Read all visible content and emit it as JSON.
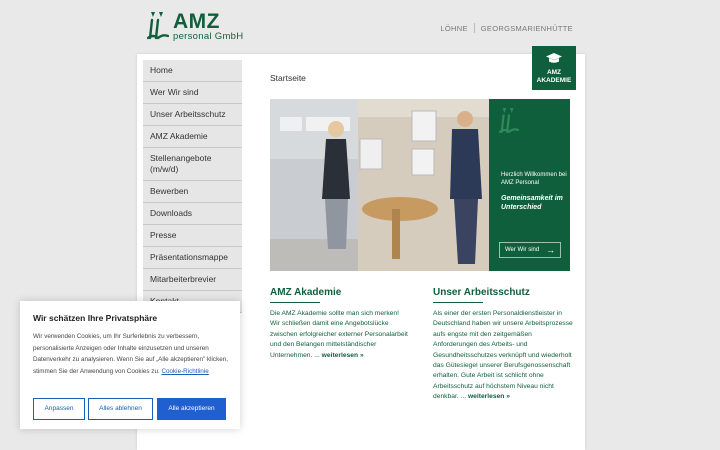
{
  "brand": {
    "title": "AMZ",
    "subtitle": "personal GmbH",
    "color": "#0f5f3c"
  },
  "topnav": {
    "items": [
      "LÖHNE",
      "GEORGSMARIENHÜTTE"
    ]
  },
  "sidebar": {
    "items": [
      {
        "label": "Home"
      },
      {
        "label": "Wer Wir sind"
      },
      {
        "label": "Unser Arbeitsschutz"
      },
      {
        "label": "AMZ Akademie"
      },
      {
        "label": "Stellenangebote (m/w/d)"
      },
      {
        "label": "Bewerben"
      },
      {
        "label": "Downloads"
      },
      {
        "label": "Presse"
      },
      {
        "label": "Präsentationsmappe"
      },
      {
        "label": "Mitarbeiterbrevier"
      },
      {
        "label": "Kontakt"
      }
    ]
  },
  "breadcrumb": "Startseite",
  "badge": {
    "line1": "AMZ",
    "line2": "AKADEMIE",
    "icon": "graduation-cap-icon"
  },
  "hero": {
    "welcome": "Herzlich Willkommen bei AMZ Personal",
    "slogan": "Gemeinsamkeit im Unterschied",
    "button": "Wer Wir sind"
  },
  "sections": [
    {
      "title": "AMZ Akademie",
      "body": "Die AMZ Akademie sollte man sich merken! Wir schließen damit eine Angebotslücke zwischen erfolgreicher externer Personalarbeit und den Belangen mittelständischer Unternehmen. ...",
      "more": "weiterlesen »"
    },
    {
      "title": "Unser Arbeitsschutz",
      "body": "Als einer der ersten Personaldienstleister in Deutschland haben wir unsere Arbeitsprozesse aufs engste mit den zeitgemäßen Anforderungen des Arbeits- und Gesundheitsschutzes verknüpft und wiederholt das Gütesiegel unserer Berufsgenossenschaft erhalten. Gute Arbeit ist schlicht ohne Arbeitsschutz auf höchstem Niveau nicht denkbar. ...",
      "more": "weiterlesen »"
    }
  ],
  "cookie": {
    "title": "Wir schätzen Ihre Privatsphäre",
    "text": "Wir verwenden Cookies, um Ihr Surferlebnis zu verbessern, personalisierte Anzeigen oder Inhalte einzusetzen und unseren Datenverkehr zu analysieren. Wenn Sie auf „Alle akzeptieren\" klicken, stimmen Sie der Anwendung von Cookies zu.",
    "link": "Cookie-Richtlinie",
    "buttons": {
      "adjust": "Anpassen",
      "reject": "Alles ablehnen",
      "accept": "Alle akzeptieren"
    },
    "accent": "#1f5fcf"
  }
}
